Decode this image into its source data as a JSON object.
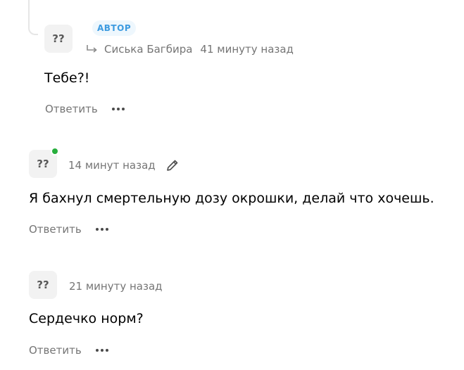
{
  "comments": [
    {
      "avatar": "??",
      "badge": "АВТОР",
      "reply_to": "Сиська Багбира",
      "time": "41 минуту назад",
      "text": "Тебе?!",
      "reply_label": "Ответить"
    },
    {
      "avatar": "??",
      "time": "14 минут назад",
      "text": "Я бахнул смертельную дозу окрошки, делай что хочешь.",
      "reply_label": "Ответить",
      "online": true,
      "edited": true
    },
    {
      "avatar": "??",
      "time": "21 минуту назад",
      "text": "Сердечко норм?",
      "reply_label": "Ответить"
    }
  ],
  "colors": {
    "badge_text": "#3d9be0",
    "badge_bg": "#eef7fd",
    "online": "#27ae3c",
    "meta": "#757575"
  },
  "icons": [
    "reply-arrow-icon",
    "pencil-icon",
    "more-dots-icon"
  ]
}
